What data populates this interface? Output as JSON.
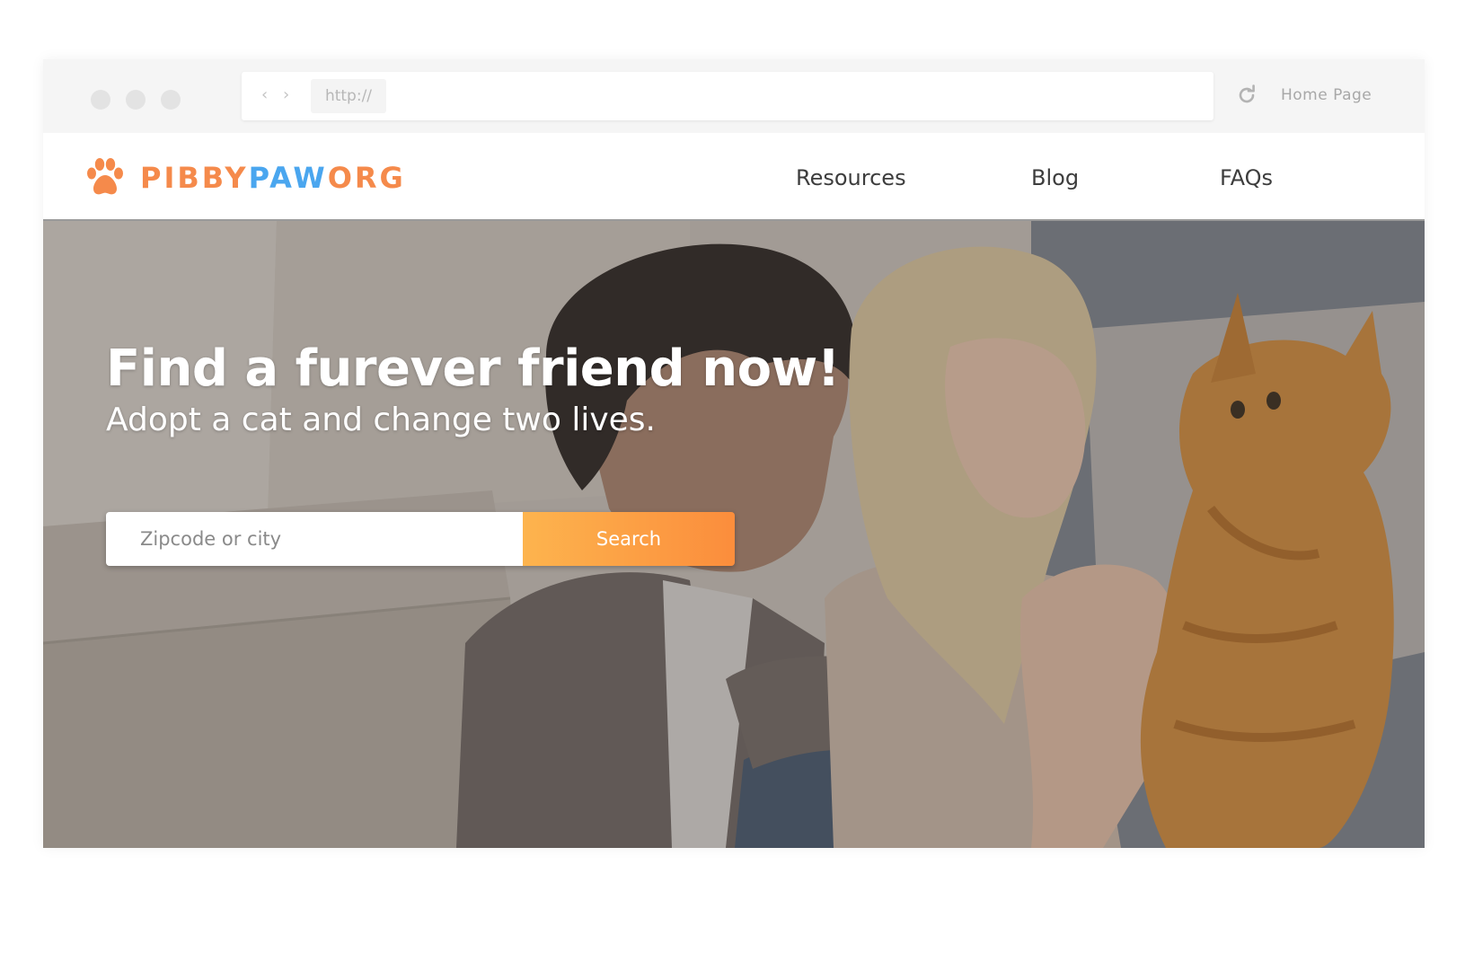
{
  "browser": {
    "address": "http://",
    "back_icon": "chevron-left-icon",
    "forward_icon": "chevron-right-icon",
    "reload_icon": "reload-icon",
    "home_label": "Home Page"
  },
  "header": {
    "logo": {
      "icon": "paw-icon",
      "part1": "PIBBY",
      "part2": "PAW",
      "part3": "ORG"
    },
    "nav": [
      {
        "label": "Resources"
      },
      {
        "label": "Blog"
      },
      {
        "label": "FAQs"
      }
    ]
  },
  "hero": {
    "title": "Find a furever friend now!",
    "subtitle": "Adopt a cat and change two lives.",
    "search": {
      "placeholder": "Zipcode or city",
      "value": "",
      "button_label": "Search"
    }
  },
  "colors": {
    "brand_orange": "#f58a4b",
    "brand_blue": "#4aa6ef",
    "button_gradient_start": "#fdb44e",
    "button_gradient_end": "#fb8d3c"
  }
}
